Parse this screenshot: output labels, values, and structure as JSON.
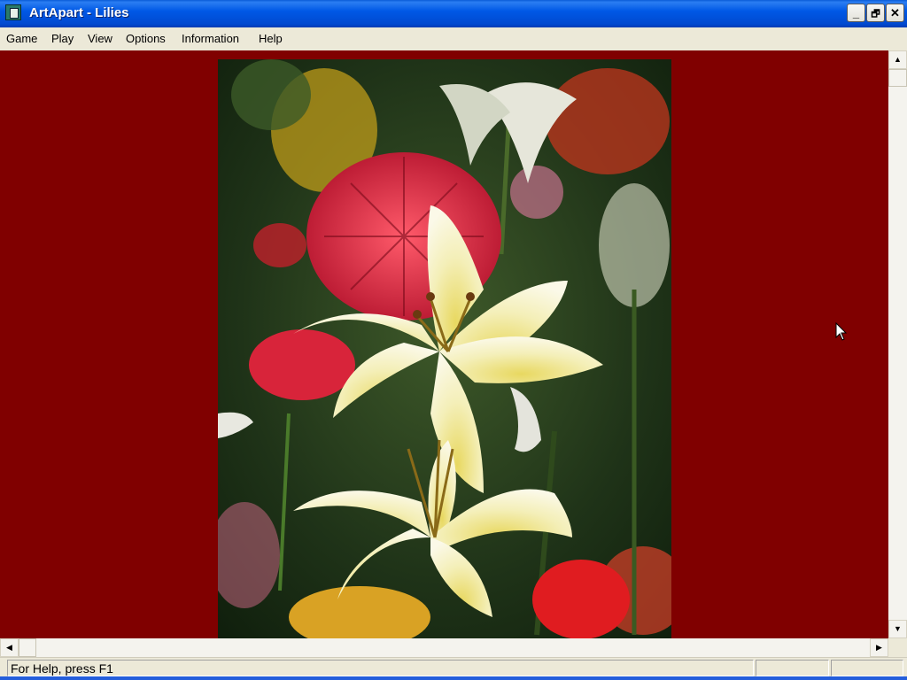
{
  "window": {
    "title": "ArtApart - Lilies",
    "controls": {
      "minimize": "_",
      "restore": "🗗",
      "close": "✕"
    }
  },
  "menu": {
    "items": [
      "Game",
      "Play",
      "View",
      "Options",
      "Information",
      "Help"
    ]
  },
  "canvas": {
    "background_color": "#800000",
    "picture_subject": "lilies"
  },
  "scrollbars": {
    "up_icon": "▲",
    "down_icon": "▼",
    "left_icon": "◀",
    "right_icon": "▶"
  },
  "status": {
    "help_text": "For Help, press F1",
    "pane2": "",
    "pane3": ""
  }
}
